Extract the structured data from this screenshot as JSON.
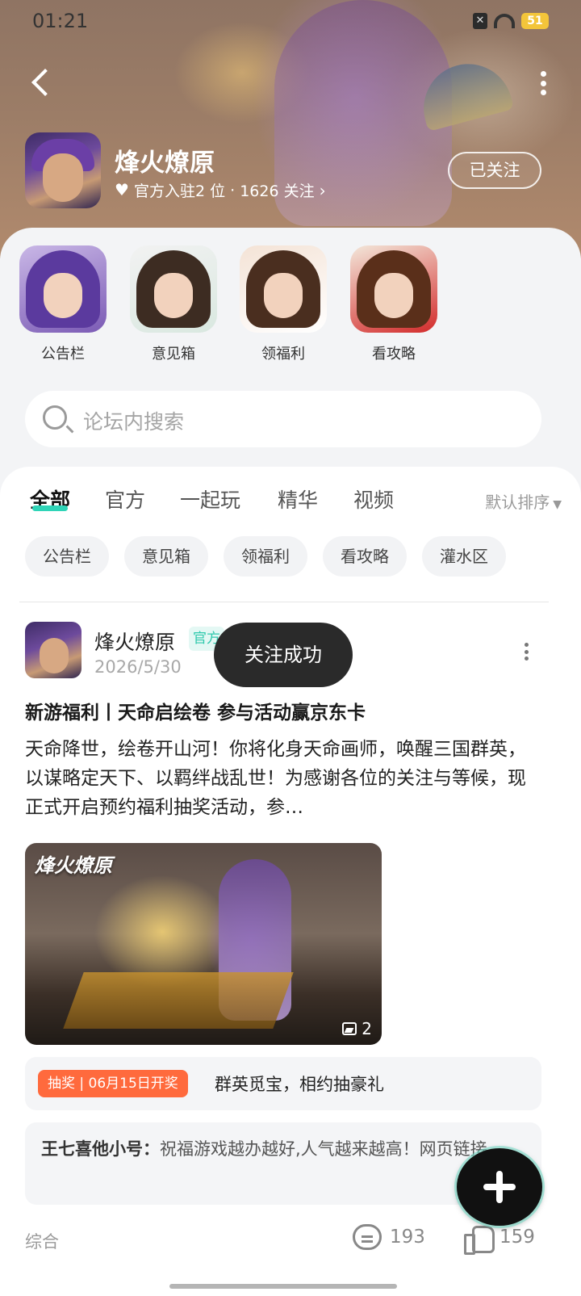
{
  "status": {
    "time": "01:21",
    "battery": "51"
  },
  "header": {
    "title": "烽火燎原",
    "meta_official": "官方入驻2 位",
    "meta_sep": "·",
    "meta_followers": "1626 关注",
    "follow_label": "已关注"
  },
  "shortcuts": [
    {
      "label": "公告栏"
    },
    {
      "label": "意见箱"
    },
    {
      "label": "领福利"
    },
    {
      "label": "看攻略"
    }
  ],
  "search": {
    "placeholder": "论坛内搜索"
  },
  "tabs": [
    {
      "label": "全部",
      "active": true
    },
    {
      "label": "官方"
    },
    {
      "label": "一起玩"
    },
    {
      "label": "精华"
    },
    {
      "label": "视频"
    }
  ],
  "sort": {
    "label": "默认排序"
  },
  "chips": [
    "公告栏",
    "意见箱",
    "领福利",
    "看攻略",
    "灌水区"
  ],
  "post": {
    "author": "烽火燎原",
    "official_tag": "官方",
    "date": "2026/5/30",
    "title": "新游福利丨天命启绘卷 参与活动赢京东卡",
    "body": "天命降世，绘卷开山河！你将化身天命画师，唤醒三国群英，以谋略定天下、以羁绊战乱世！为感谢各位的关注与等候，现正式开启预约福利抽奖活动，参…",
    "image_logo": "烽火燎原",
    "image_count": "2",
    "lottery_tag": "抽奖 | 06月15日开奖",
    "lottery_text": "群英觅宝，相约抽豪礼",
    "comment_user": "王七喜他小号：",
    "comment_text": "祝福游戏越办越好,人气越来越高！网页链接",
    "category": "综合",
    "comments": "193",
    "likes": "159"
  },
  "toast": "关注成功",
  "colors": {
    "accent": "#2fd4b7",
    "lottery": "#ff6a3d",
    "toast_bg": "#2a2a2a"
  }
}
